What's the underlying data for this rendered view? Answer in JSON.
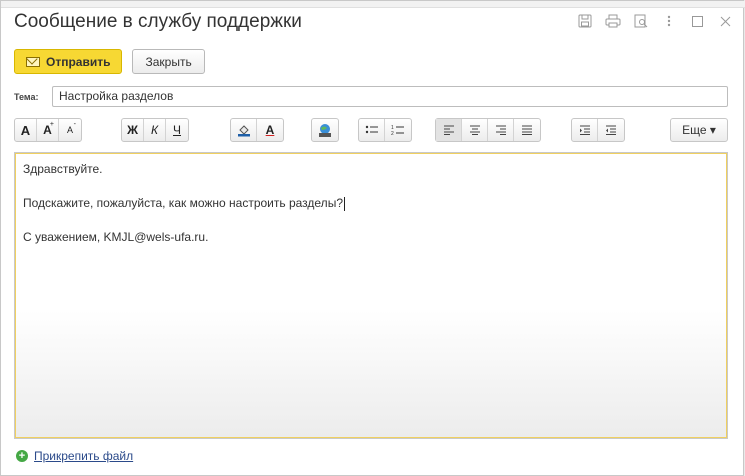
{
  "window": {
    "title": "Сообщение в службу поддержки",
    "controls": [
      "floppy-icon",
      "print-icon",
      "preview-icon",
      "more-vertical-icon",
      "maximize-icon",
      "close-icon"
    ]
  },
  "actions": {
    "send_label": "Отправить",
    "close_label": "Закрыть"
  },
  "subject": {
    "label": "Тема:",
    "value": "Настройка разделов"
  },
  "format_toolbar": {
    "more_label": "Еще ▾",
    "font_a": "A",
    "font_bigger": "A",
    "font_smaller": "A",
    "bold": "Ж",
    "italic": "К",
    "underline": "Ч",
    "text_color": "A"
  },
  "message": {
    "line1": "Здравствуйте.",
    "line2": "Подскажите, пожалуйста, как можно настроить разделы?",
    "line3": "С уважением, KMJL@wels-ufa.ru."
  },
  "attach": {
    "label": "Прикрепить файл"
  },
  "colors": {
    "primary_button": "#f7d833",
    "link": "#2b4a8a",
    "attach_icon": "#45a845"
  }
}
